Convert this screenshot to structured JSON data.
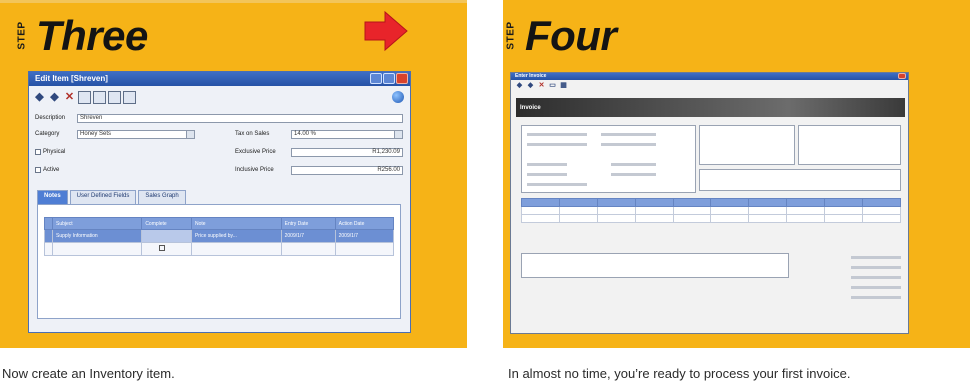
{
  "left": {
    "step_label": "STEP",
    "step_word": "Three",
    "caption": "Now create an Inventory item.",
    "window": {
      "title": "Edit Item [Shreven]",
      "description_label": "Description",
      "description_value": "Shreven",
      "category_label": "Category",
      "category_value": "Honey Sets",
      "physical_label": "Physical",
      "active_label": "Active",
      "tax_label": "Tax on Sales",
      "tax_value": "14.00 %",
      "excl_label": "Exclusive Price",
      "excl_value": "R1,230.09",
      "incl_label": "Inclusive Price",
      "incl_value": "R256.00",
      "tabs": [
        "Notes",
        "User Defined Fields",
        "Sales Graph"
      ],
      "grid": {
        "columns": [
          "Subject",
          "Complete",
          "Note",
          "Entry Date",
          "Action Date"
        ],
        "rows": [
          [
            "Supply Information",
            "",
            "Price supplied by...",
            "2009/1/7",
            "2009/1/7"
          ]
        ]
      }
    }
  },
  "right": {
    "step_label": "STEP",
    "step_word": "Four",
    "caption": "In almost no time, you’re ready to process your first invoice.",
    "window": {
      "title": "Enter Invoice",
      "band_label": "Invoice"
    }
  },
  "colors": {
    "panel": "#f6b317",
    "arrow": "#e8242a",
    "window_title": "#2f5fb8",
    "grid_header": "#7e9edb"
  }
}
